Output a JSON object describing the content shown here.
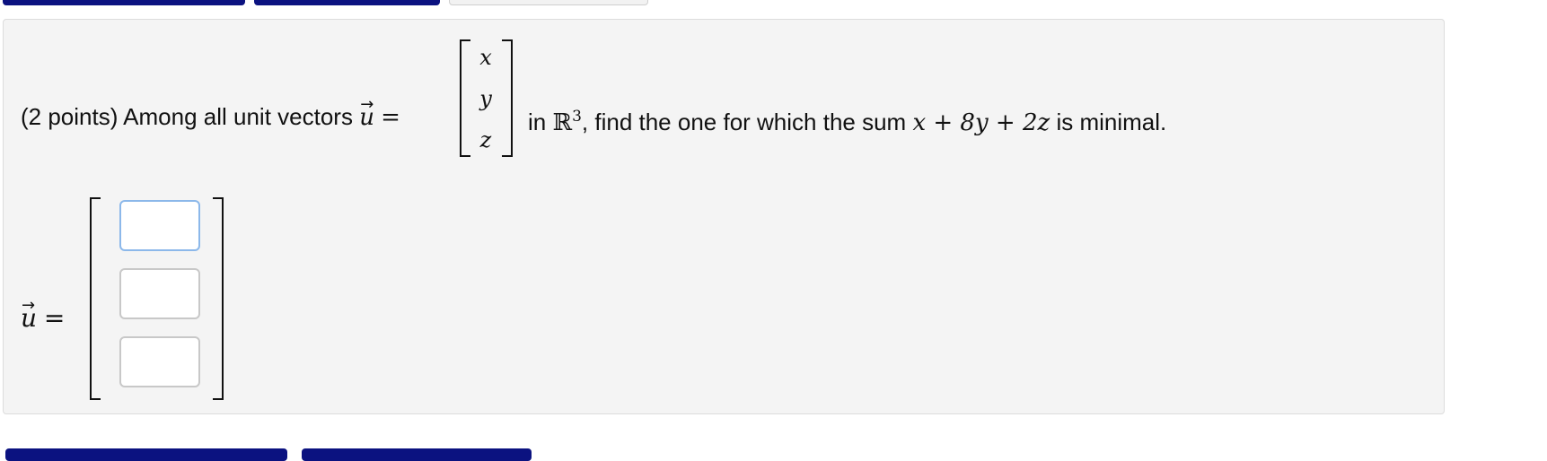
{
  "problem": {
    "prefix": "(2 points) Among all unit vectors ",
    "vector_symbol": "u",
    "equals": "=",
    "matrix_entries": [
      "x",
      "y",
      "z"
    ],
    "in_text": "in ",
    "space_symbol": "ℝ",
    "space_exponent": "3",
    "after_text": ", find the one for which the sum ",
    "expression": "x + 8y + 2z",
    "suffix": " is minimal."
  },
  "answer": {
    "vector_symbol": "u",
    "equals": "=",
    "inputs": [
      {
        "value": ""
      },
      {
        "value": ""
      },
      {
        "value": ""
      }
    ]
  }
}
